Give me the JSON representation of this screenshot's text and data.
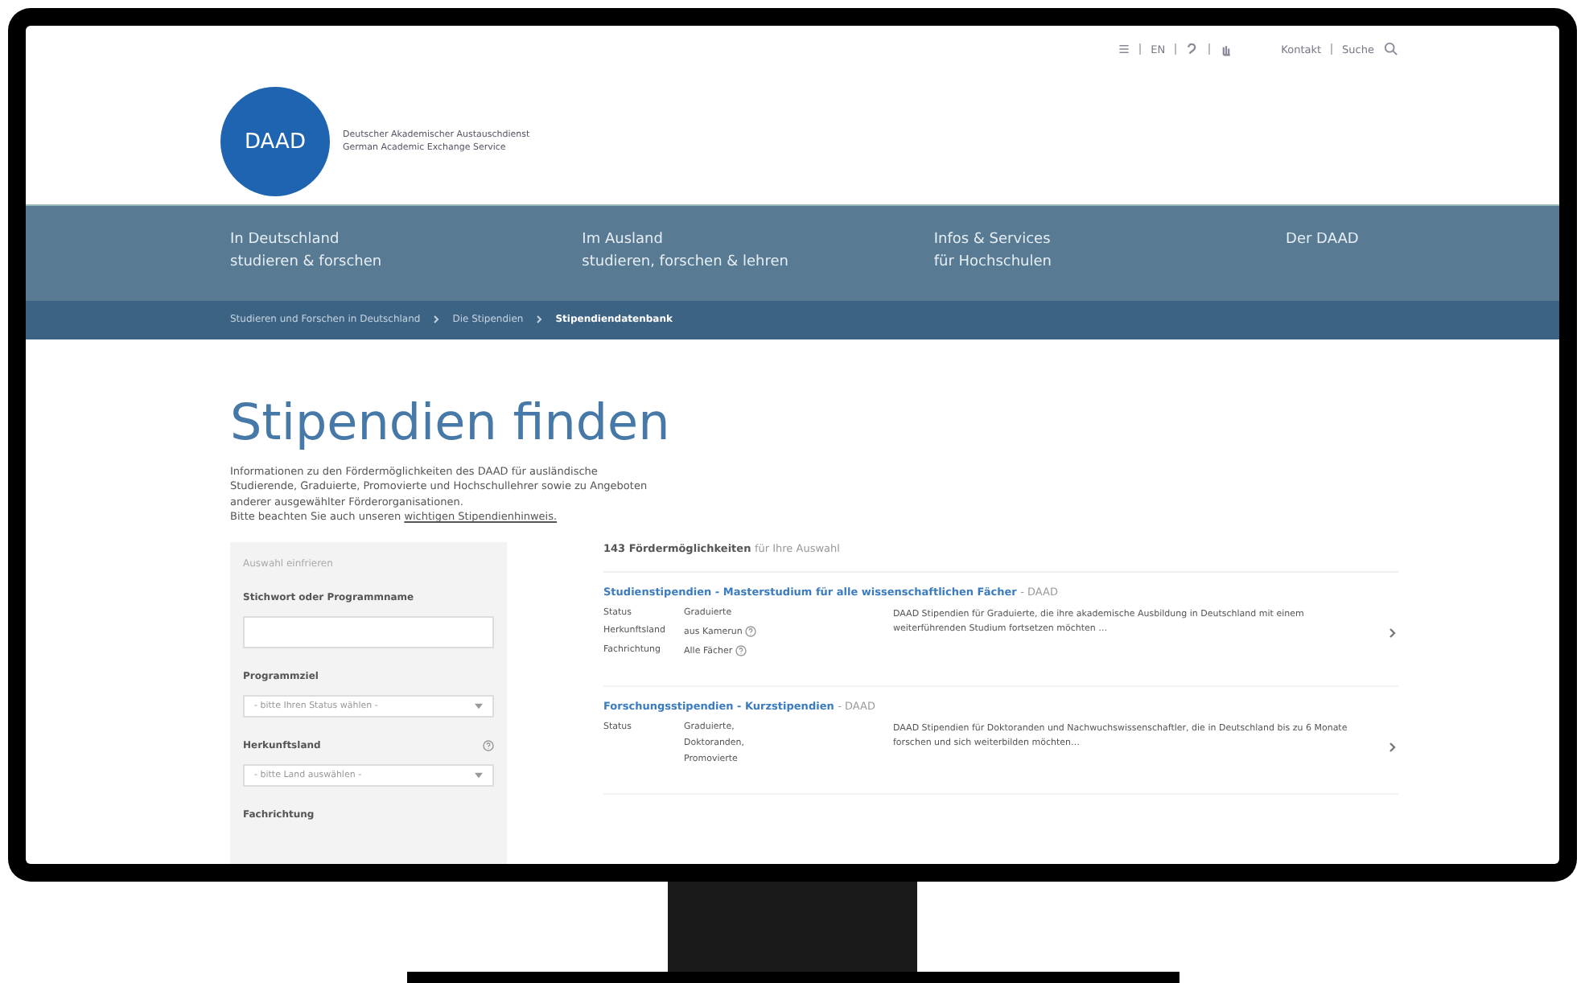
{
  "header": {
    "logo": "DAAD",
    "org_name": [
      "Deutscher Akademischer Austauschdienst",
      "German Academic Exchange Service"
    ],
    "utility": [
      "EN"
    ],
    "links": [
      "Kontakt",
      "Suche"
    ]
  },
  "nav": [
    {
      "line1": "In Deutschland",
      "line2": "studieren & forschen"
    },
    {
      "line1": "Im Ausland",
      "line2": "studieren, forschen & lehren"
    },
    {
      "line1": "Infos & Services",
      "line2": "für Hochschulen"
    },
    {
      "line1": "Der DAAD"
    }
  ],
  "breadcrumb": [
    {
      "label": "Studieren und Forschen in Deutschland",
      "current": false
    },
    {
      "label": "Die Stipendien",
      "current": false
    },
    {
      "label": "Stipendiendatenbank",
      "current": true
    }
  ],
  "page": {
    "title": "Stipendien finden",
    "intro": [
      "Informationen zu den Fördermöglichkeiten des DAAD für ausländische",
      "Studierende, Graduierte, Promovierte und Hochschullehrer sowie zu Angeboten",
      "anderer ausgewählter Förderorganisationen."
    ],
    "notice": "Bitte beachten Sie auch unseren",
    "notice_link": "wichtigen Stipendienhinweis."
  },
  "filters": {
    "reset": "Auswahl einfrieren",
    "fields": [
      {
        "kind": "text",
        "label": "Stichwort oder Programmname",
        "help": false
      },
      {
        "kind": "select",
        "label": "Programmziel",
        "help": false,
        "value": "- bitte Ihren Status wählen -"
      },
      {
        "kind": "select",
        "label": "Herkunftsland",
        "help": true,
        "value": "- bitte Land auswählen -"
      },
      {
        "kind": "heading",
        "label": "Fachrichtung",
        "help": false
      }
    ]
  },
  "results": {
    "count": "143 Fördermöglichkeiten",
    "count_note": "für Ihre Auswahl",
    "items": [
      {
        "title": "Studienstipendien - Masterstudium für alle wissenschaftlichen Fächer",
        "source": "- DAAD",
        "rows": [
          {
            "label": "Status",
            "value": [
              "Graduierte"
            ],
            "help": false
          },
          {
            "label": "Herkunftsland",
            "value": [
              "aus Kamerun"
            ],
            "help": true
          },
          {
            "label": "Fachrichtung",
            "value": [
              "Alle Fächer"
            ],
            "help": true
          }
        ],
        "description": "DAAD Stipendien für Graduierte, die ihre akademische Ausbildung in Deutschland mit einem weiterführenden Studium fortsetzen möchten …"
      },
      {
        "title": "Forschungsstipendien - Kurzstipendien",
        "source": "- DAAD",
        "rows": [
          {
            "label": "Status",
            "value": [
              "Graduierte,",
              "Doktoranden,",
              "Promovierte"
            ],
            "help": false
          }
        ],
        "description": "DAAD Stipendien für Doktoranden und Nachwuchswissenschaftler, die in Deutschland bis zu 6 Monate forschen und sich weiterbilden möchten…"
      }
    ]
  }
}
